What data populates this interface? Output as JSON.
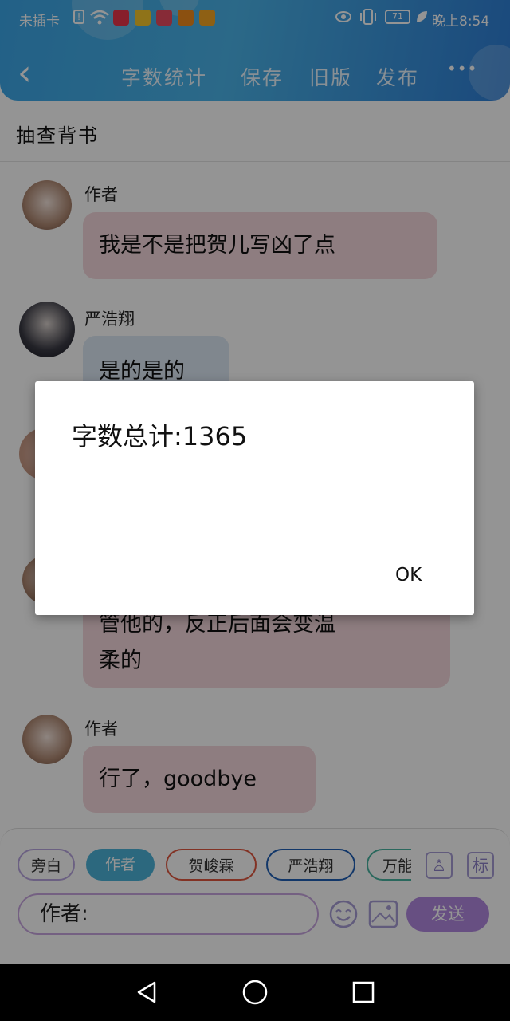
{
  "status_bar": {
    "carrier": "未插卡",
    "battery": "71",
    "time": "晚上8:54",
    "apps": [
      {
        "name": "小红书",
        "color": "#e8344a"
      },
      {
        "name": "yellow-app",
        "color": "#f7c72c"
      },
      {
        "name": "HUAWEI",
        "color": "#e84a5f"
      },
      {
        "name": "video",
        "color": "#f08a1d"
      },
      {
        "name": "app",
        "color": "#f5a623"
      }
    ]
  },
  "header": {
    "back": "‹",
    "nav": [
      "字数统计",
      "保存",
      "旧版",
      "发布"
    ],
    "more": "•••"
  },
  "title": "抽查背书",
  "messages": [
    {
      "name": "作者",
      "text": "我是不是把贺儿写凶了点"
    },
    {
      "name": "严浩翔",
      "text": "是的是的"
    },
    {
      "text_line1": "管他的，反正后面会变温",
      "text_line2": "柔的"
    },
    {
      "name": "作者",
      "text": "行了，goodbye"
    }
  ],
  "dialog": {
    "text": "字数总计:1365",
    "ok": "OK"
  },
  "compose": {
    "chips": [
      "旁白",
      "作者",
      "贺峻霖",
      "严浩翔",
      "万能"
    ],
    "chip_colors": [
      "#b9a6e0",
      "#4db4d9",
      "#e0563f",
      "#1f5fb6",
      "#49b3a0"
    ],
    "btn_person": "♙",
    "btn_mark": "标",
    "input_value": "作者:",
    "send": "发送"
  },
  "colors": {
    "accent": "#3ca7e8",
    "send": "#b289e0"
  }
}
